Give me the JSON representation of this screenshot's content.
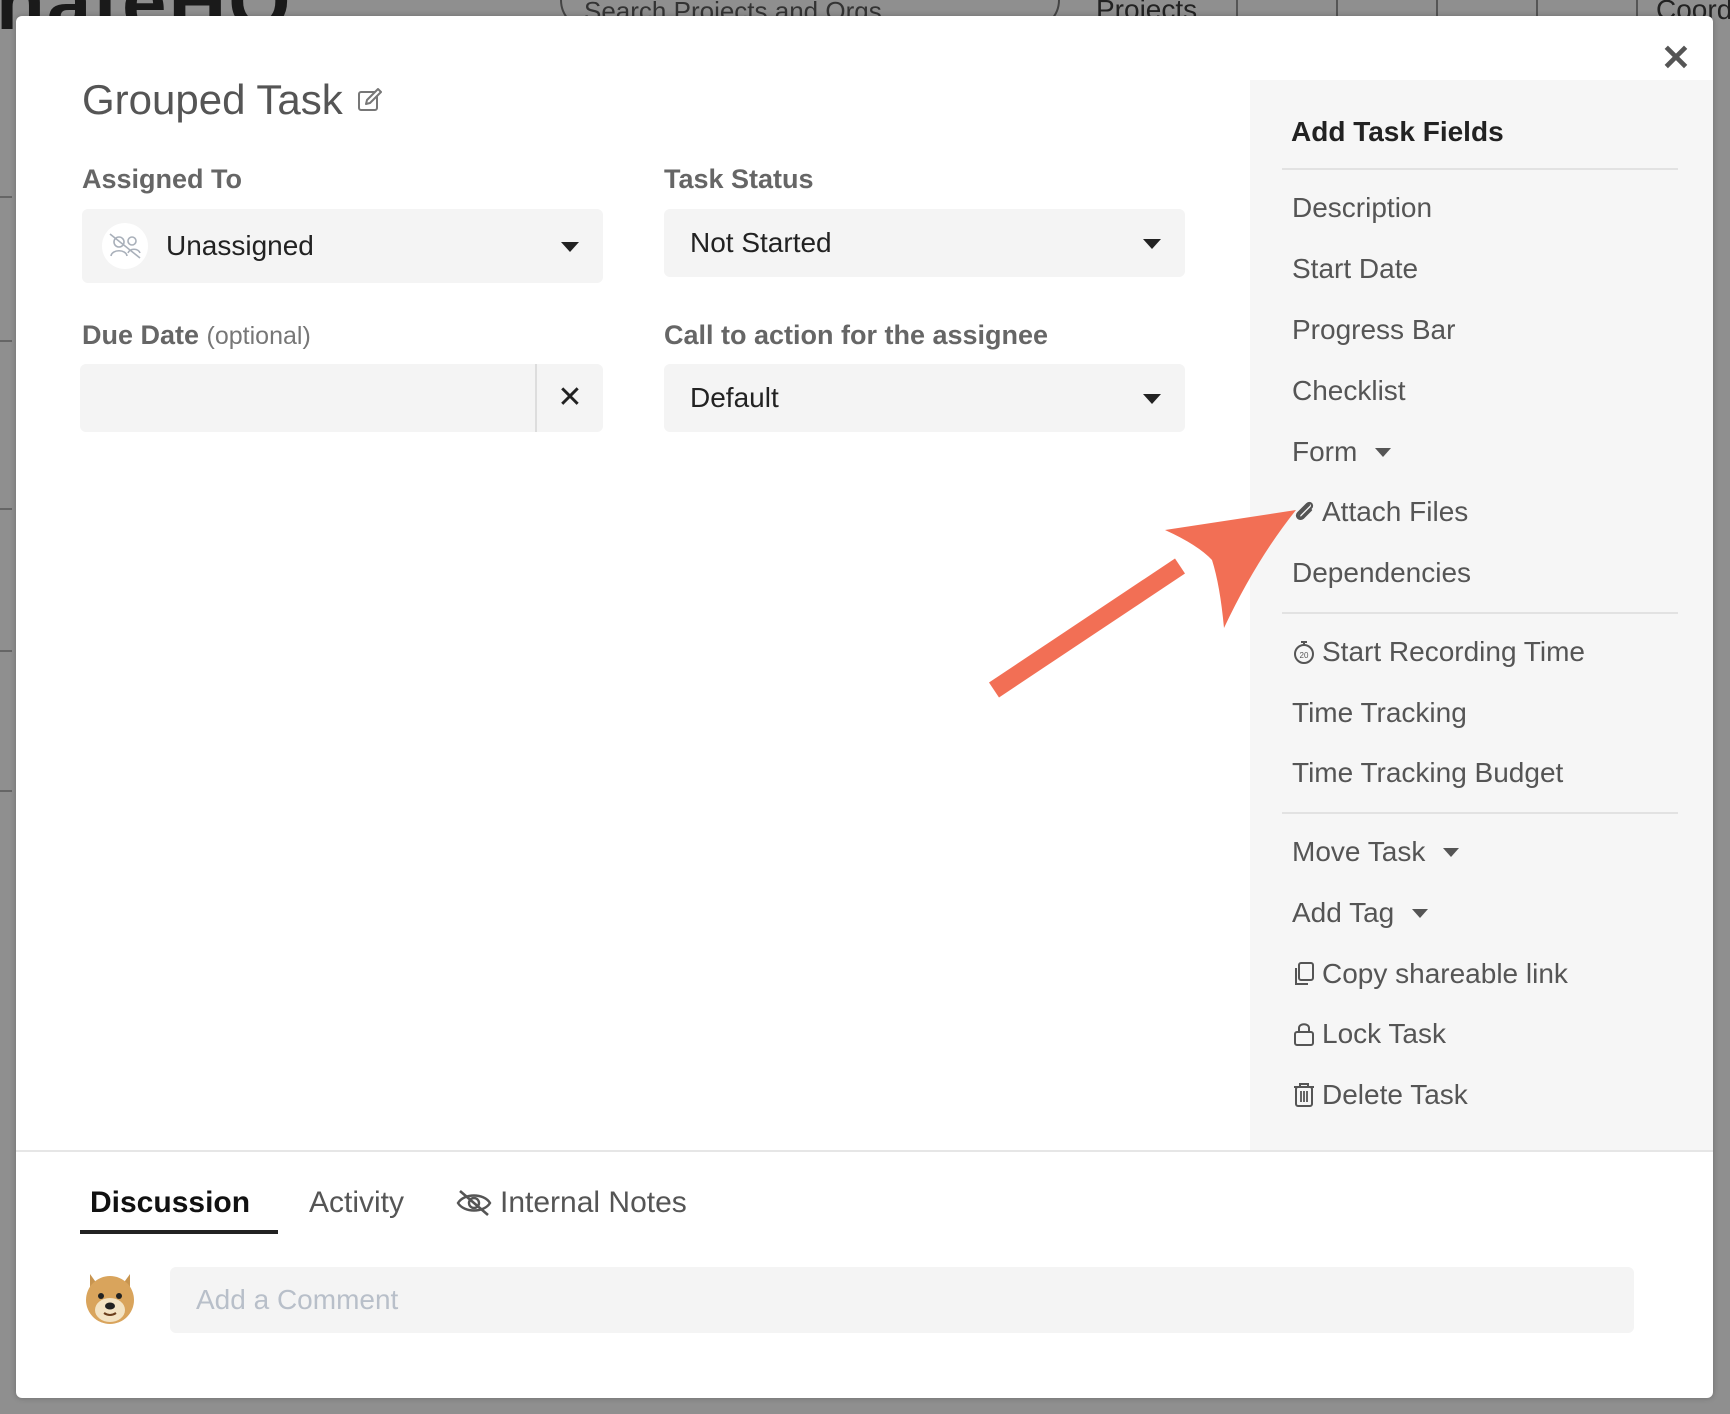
{
  "background": {
    "logo_text": "nateHQ",
    "search_placeholder": "Search Projects and Orgs",
    "projects_label": "Projects",
    "coord_label": "Coord"
  },
  "modal": {
    "title": "Grouped Task",
    "close_icon": "close-icon",
    "assigned_to": {
      "label": "Assigned To",
      "value": "Unassigned"
    },
    "task_status": {
      "label": "Task Status",
      "value": "Not Started"
    },
    "due_date": {
      "label": "Due Date",
      "optional": "(optional)",
      "value": "",
      "clear_symbol": "✕"
    },
    "call_to_action": {
      "label": "Call to action for the assignee",
      "value": "Default"
    }
  },
  "side_panel": {
    "title": "Add Task Fields",
    "group1": [
      {
        "label": "Description"
      },
      {
        "label": "Start Date"
      },
      {
        "label": "Progress Bar"
      },
      {
        "label": "Checklist"
      },
      {
        "label": "Form",
        "has_caret": true
      },
      {
        "label": "Attach Files",
        "icon": "paperclip-icon"
      },
      {
        "label": "Dependencies"
      }
    ],
    "group2": [
      {
        "label": "Start Recording Time",
        "icon": "stopwatch-icon"
      },
      {
        "label": "Time Tracking"
      },
      {
        "label": "Time Tracking Budget"
      }
    ],
    "group3": [
      {
        "label": "Move Task",
        "has_caret": true
      },
      {
        "label": "Add Tag",
        "has_caret": true
      },
      {
        "label": "Copy shareable link",
        "icon": "copy-icon"
      },
      {
        "label": "Lock Task",
        "icon": "lock-icon"
      },
      {
        "label": "Delete Task",
        "icon": "trash-icon"
      }
    ]
  },
  "tabs": [
    {
      "label": "Discussion",
      "active": true
    },
    {
      "label": "Activity",
      "active": false
    },
    {
      "label": "Internal Notes",
      "active": false,
      "icon": "eye-slash-icon"
    }
  ],
  "comment": {
    "placeholder": "Add a Comment"
  },
  "annotation": {
    "arrow_color": "#f26f55",
    "points_to": "Attach Files"
  }
}
